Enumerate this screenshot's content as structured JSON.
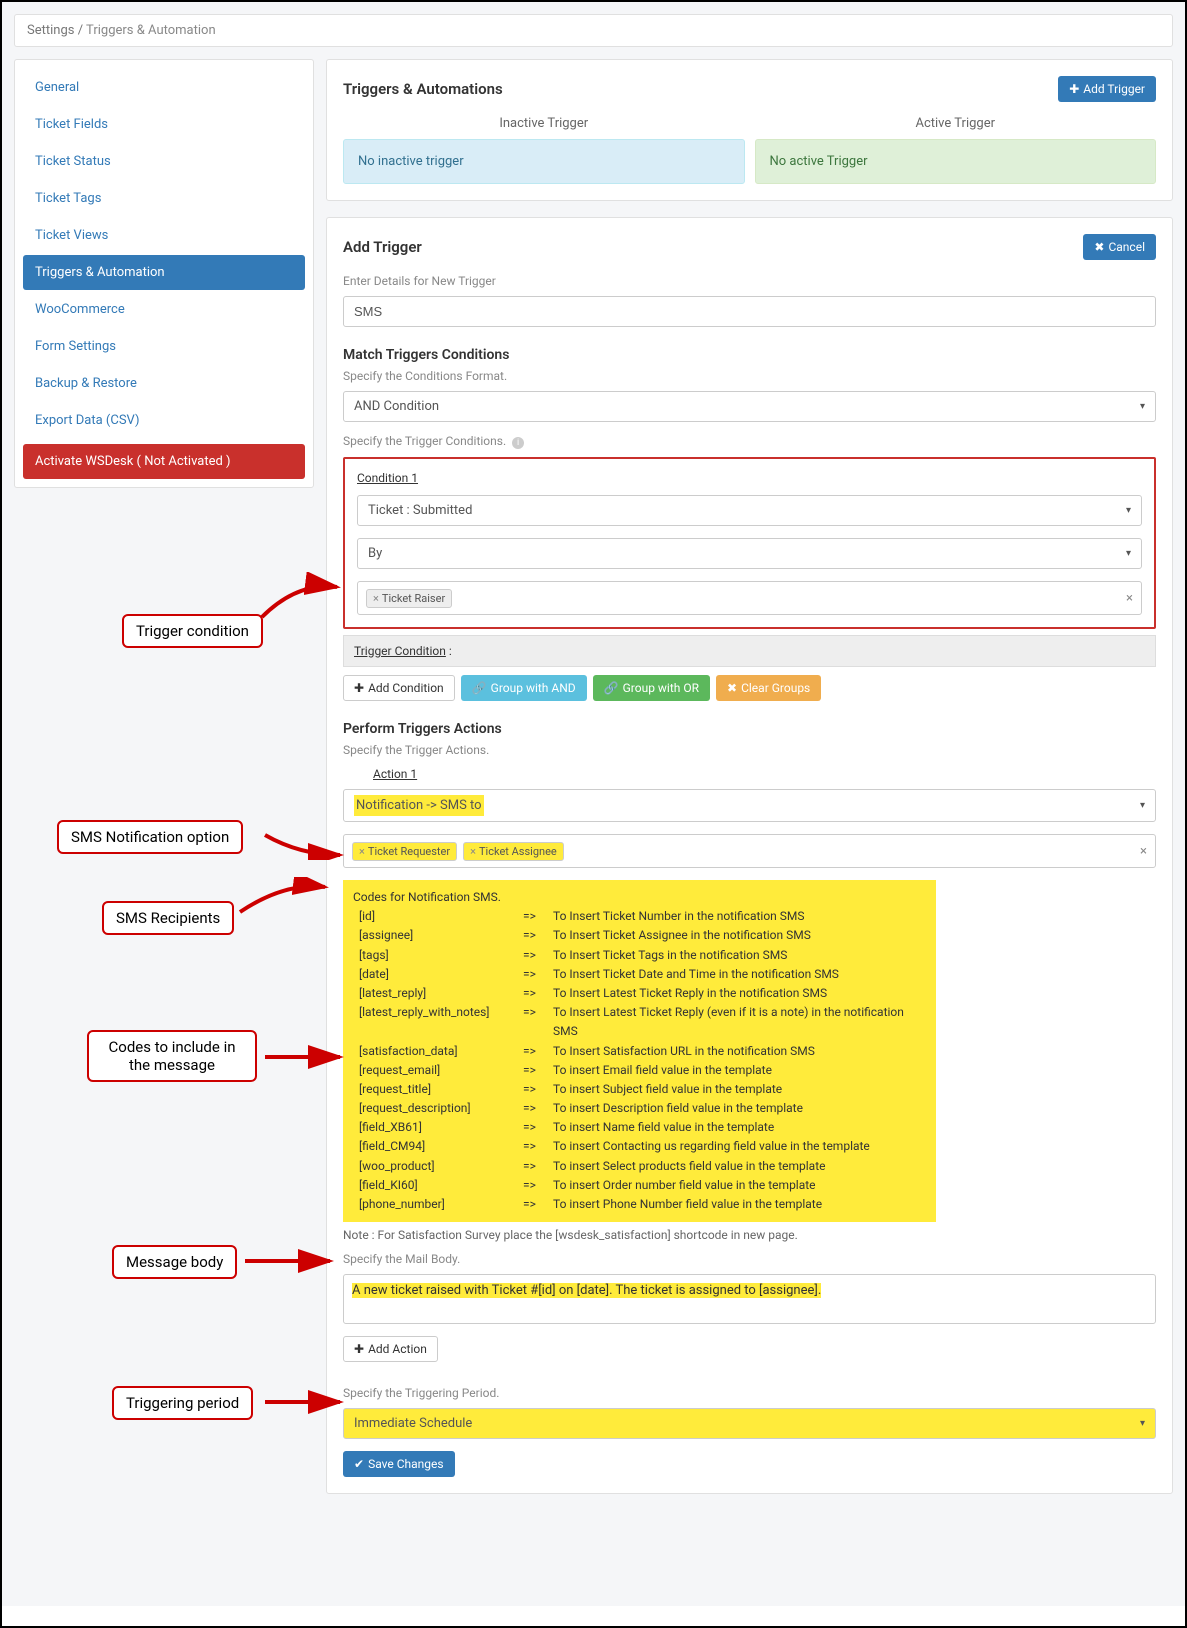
{
  "breadcrumb": {
    "root": "Settings",
    "current": "Triggers & Automation"
  },
  "sidebar": {
    "items": [
      {
        "label": "General"
      },
      {
        "label": "Ticket Fields"
      },
      {
        "label": "Ticket Status"
      },
      {
        "label": "Ticket Tags"
      },
      {
        "label": "Ticket Views"
      },
      {
        "label": "Triggers & Automation"
      },
      {
        "label": "WooCommerce"
      },
      {
        "label": "Form Settings"
      },
      {
        "label": "Backup & Restore"
      },
      {
        "label": "Export Data (CSV)"
      }
    ],
    "activate_label": "Activate WSDesk ( Not Activated )"
  },
  "triggers_panel": {
    "heading": "Triggers & Automations",
    "add_trigger": "Add Trigger",
    "inactive_title": "Inactive Trigger",
    "inactive_text": "No inactive trigger",
    "active_title": "Active Trigger",
    "active_text": "No active Trigger"
  },
  "add_trigger": {
    "heading": "Add Trigger",
    "cancel": "Cancel",
    "details_label": "Enter Details for New Trigger",
    "name_value": "SMS"
  },
  "conditions": {
    "heading": "Match Triggers Conditions",
    "format_label": "Specify the Conditions Format.",
    "format_value": "AND Condition",
    "trigger_cond_label": "Specify the Trigger Conditions.",
    "cond1_title": "Condition 1",
    "cond1_sel1": "Ticket : Submitted",
    "cond1_sel2": "By",
    "cond1_tag": "Ticket Raiser",
    "bar_label": "Trigger Condition",
    "bar_colon": " :",
    "add_condition": "Add Condition",
    "group_and": "Group with AND",
    "group_or": "Group with OR",
    "clear_groups": "Clear Groups"
  },
  "actions": {
    "heading": "Perform Triggers Actions",
    "sub": "Specify the Trigger Actions.",
    "action1_title": "Action 1",
    "notif_value": "Notification -> SMS to",
    "tag1": "Ticket Requester",
    "tag2": "Ticket Assignee",
    "codes_header": "Codes for Notification SMS.",
    "codes": [
      {
        "code": "[id]",
        "desc": "To Insert Ticket Number in the notification SMS"
      },
      {
        "code": "[assignee]",
        "desc": "To Insert Ticket Assignee in the notification SMS"
      },
      {
        "code": "[tags]",
        "desc": "To Insert Ticket Tags in the notification SMS"
      },
      {
        "code": "[date]",
        "desc": "To Insert Ticket Date and Time in the notification SMS"
      },
      {
        "code": "[latest_reply]",
        "desc": "To Insert Latest Ticket Reply in the notification SMS"
      },
      {
        "code": "[latest_reply_with_notes]",
        "desc": "To Insert Latest Ticket Reply (even if it is a note) in the notification SMS"
      },
      {
        "code": "[satisfaction_data]",
        "desc": "To Insert Satisfaction URL in the notification SMS"
      },
      {
        "code": "[request_email]",
        "desc": "To insert Email field value in the template"
      },
      {
        "code": "[request_title]",
        "desc": "To insert Subject field value in the template"
      },
      {
        "code": "[request_description]",
        "desc": "To insert Description field value in the template"
      },
      {
        "code": "[field_XB61]",
        "desc": "To insert Name field value in the template"
      },
      {
        "code": "[field_CM94]",
        "desc": "To insert Contacting us regarding field value in the template"
      },
      {
        "code": "[woo_product]",
        "desc": "To insert Select products field value in the template"
      },
      {
        "code": "[field_KI60]",
        "desc": "To insert Order number field value in the template"
      },
      {
        "code": "[phone_number]",
        "desc": "To insert Phone Number field value in the template"
      }
    ],
    "note": "Note : For Satisfaction Survey place the [wsdesk_satisfaction] shortcode in new page.",
    "mail_body_label": "Specify the Mail Body.",
    "mail_body_value": "A new ticket raised with Ticket #[id] on [date]. The ticket is assigned to [assignee].",
    "add_action": "Add Action"
  },
  "period": {
    "label": "Specify the Triggering Period.",
    "value": "Immediate Schedule"
  },
  "save": "Save Changes",
  "callouts": {
    "trigger_condition": "Trigger condition",
    "sms_option": "SMS Notification option",
    "sms_recipients": "SMS Recipients",
    "codes": "Codes to include in the message",
    "message_body": "Message body",
    "triggering_period": "Triggering period"
  }
}
